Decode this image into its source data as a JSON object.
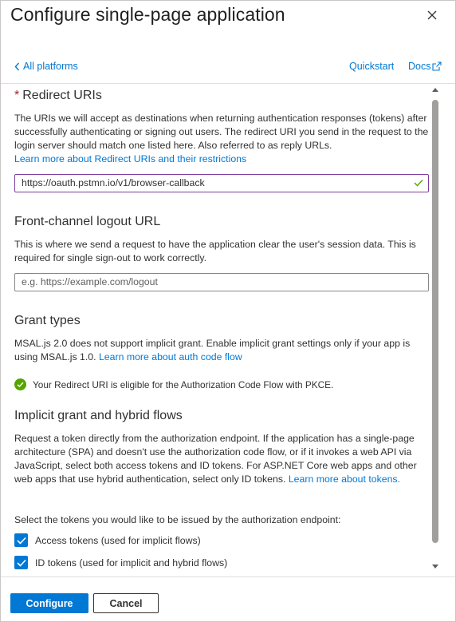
{
  "dialog": {
    "title": "Configure single-page application"
  },
  "nav": {
    "back_label": "All platforms",
    "quickstart_label": "Quickstart",
    "docs_label": "Docs"
  },
  "redirect": {
    "required_marker": "*",
    "heading": "Redirect URIs",
    "description": "The URIs we will accept as destinations when returning authentication responses (tokens) after successfully authenticating or signing out users. The redirect URI you send in the request to the login server should match one listed here. Also referred to as reply URLs.",
    "learn_more": "Learn more about Redirect URIs and their restrictions",
    "value": "https://oauth.pstmn.io/v1/browser-callback"
  },
  "logout": {
    "heading": "Front-channel logout URL",
    "description": "This is where we send a request to have the application clear the user's session data. This is required for single sign-out to work correctly.",
    "placeholder": "e.g. https://example.com/logout"
  },
  "grant": {
    "heading": "Grant types",
    "description": "MSAL.js 2.0 does not support implicit grant. Enable implicit grant settings only if your app is using MSAL.js 1.0.",
    "learn_more": "Learn more about auth code flow",
    "status": "Your Redirect URI is eligible for the Authorization Code Flow with PKCE."
  },
  "implicit": {
    "heading": "Implicit grant and hybrid flows",
    "description": "Request a token directly from the authorization endpoint. If the application has a single-page architecture (SPA) and doesn't use the authorization code flow, or if it invokes a web API via JavaScript, select both access tokens and ID tokens. For ASP.NET Core web apps and other web apps that use hybrid authentication, select only ID tokens.",
    "learn_more": "Learn more about tokens.",
    "select_prompt": "Select the tokens you would like to be issued by the authorization endpoint:",
    "access_tokens_label": "Access tokens (used for implicit flows)",
    "id_tokens_label": "ID tokens (used for implicit and hybrid flows)",
    "access_tokens_checked": true,
    "id_tokens_checked": true
  },
  "footer": {
    "configure_label": "Configure",
    "cancel_label": "Cancel"
  },
  "colors": {
    "accent": "#0078d4",
    "success": "#57a300",
    "required": "#a4262c"
  }
}
